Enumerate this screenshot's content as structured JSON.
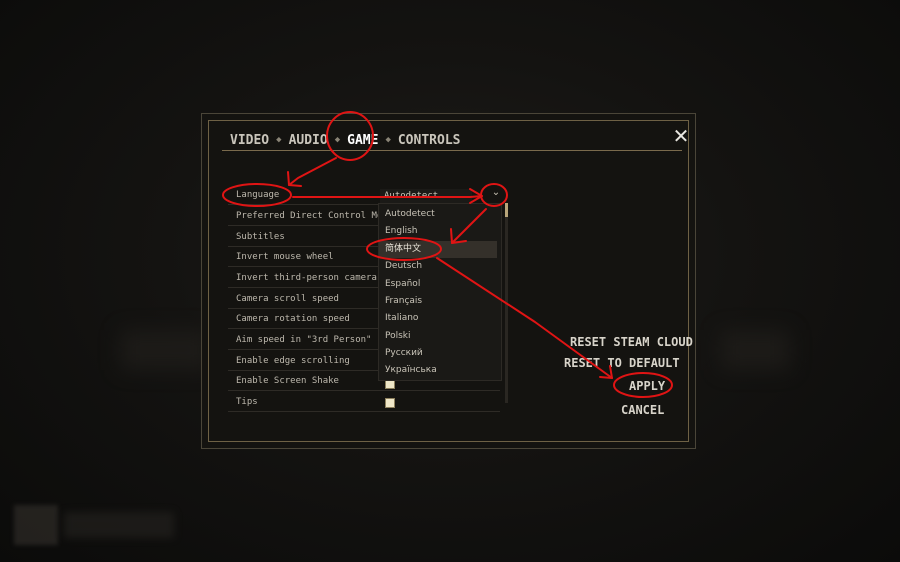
{
  "tabs": [
    {
      "label": "VIDEO"
    },
    {
      "label": "AUDIO"
    },
    {
      "label": "GAME"
    },
    {
      "label": "CONTROLS"
    }
  ],
  "active_tab": "GAME",
  "tab_separator": "◆",
  "close_glyph": "✕",
  "settings": [
    {
      "label": "Language"
    },
    {
      "label": "Preferred Direct Control Mode"
    },
    {
      "label": "Subtitles"
    },
    {
      "label": "Invert mouse wheel"
    },
    {
      "label": "Invert third-person camera"
    },
    {
      "label": "Camera scroll speed"
    },
    {
      "label": "Camera rotation speed"
    },
    {
      "label": "Aim speed in \"3rd Person\""
    },
    {
      "label": "Enable edge scrolling"
    },
    {
      "label": "Enable Screen Shake"
    },
    {
      "label": "Tips"
    }
  ],
  "language_dropdown": {
    "current_value": "Autodetect",
    "arrow_glyph": "⌄",
    "options": [
      {
        "label": "Autodetect"
      },
      {
        "label": "English"
      },
      {
        "label": "简体中文"
      },
      {
        "label": "Deutsch"
      },
      {
        "label": "Español"
      },
      {
        "label": "Français"
      },
      {
        "label": "Italiano"
      },
      {
        "label": "Polski"
      },
      {
        "label": "Русский"
      },
      {
        "label": "Українська"
      }
    ],
    "highlighted_option": "简体中文"
  },
  "actions": {
    "reset_steam_cloud": "RESET STEAM CLOUD",
    "reset_to_default": "RESET TO DEFAULT",
    "apply": "APPLY",
    "cancel": "CANCEL"
  },
  "colors": {
    "annotation_red": "#e01414",
    "frame_gold": "#6e6145",
    "text_light": "#d8d4ca"
  }
}
